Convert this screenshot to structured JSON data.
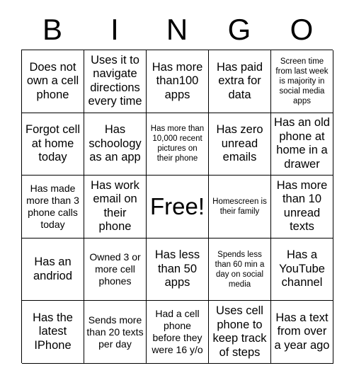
{
  "header": {
    "letters": [
      "B",
      "I",
      "N",
      "G",
      "O"
    ]
  },
  "grid": {
    "columns": 5,
    "rows": 5,
    "cells": [
      {
        "text": "Does not own a cell phone",
        "size": "md"
      },
      {
        "text": "Uses it to navigate directions every time",
        "size": "md"
      },
      {
        "text": "Has more than100 apps",
        "size": "md"
      },
      {
        "text": "Has paid extra for data",
        "size": "md"
      },
      {
        "text": "Screen time from last week is majority in social media apps",
        "size": "xs"
      },
      {
        "text": "Forgot cell at home today",
        "size": "md"
      },
      {
        "text": "Has schoology as an app",
        "size": "md"
      },
      {
        "text": "Has more than 10,000 recent pictures on their phone",
        "size": "xs"
      },
      {
        "text": "Has zero unread emails",
        "size": "md"
      },
      {
        "text": "Has an old phone at home in a drawer",
        "size": "md"
      },
      {
        "text": "Has made more than 3 phone calls today",
        "size": "sm"
      },
      {
        "text": "Has work email on their phone",
        "size": "md"
      },
      {
        "text": "Free!",
        "size": "lg"
      },
      {
        "text": "Homescreen is their family",
        "size": "xs"
      },
      {
        "text": "Has more than 10 unread texts",
        "size": "md"
      },
      {
        "text": "Has an andriod",
        "size": "md"
      },
      {
        "text": "Owned 3 or more cell phones",
        "size": "sm"
      },
      {
        "text": "Has less than 50 apps",
        "size": "md"
      },
      {
        "text": "Spends less than 60 min a day on social media",
        "size": "xs"
      },
      {
        "text": "Has a YouTube channel",
        "size": "md"
      },
      {
        "text": "Has the latest IPhone",
        "size": "md"
      },
      {
        "text": "Sends more than 20 texts per day",
        "size": "sm"
      },
      {
        "text": "Had a cell phone before they were 16 y/o",
        "size": "sm"
      },
      {
        "text": "Uses cell phone to keep track of steps",
        "size": "md"
      },
      {
        "text": "Has a text from over a year ago",
        "size": "md"
      }
    ]
  },
  "colors": {
    "background": "#ffffff",
    "text": "#000000",
    "border": "#000000"
  }
}
